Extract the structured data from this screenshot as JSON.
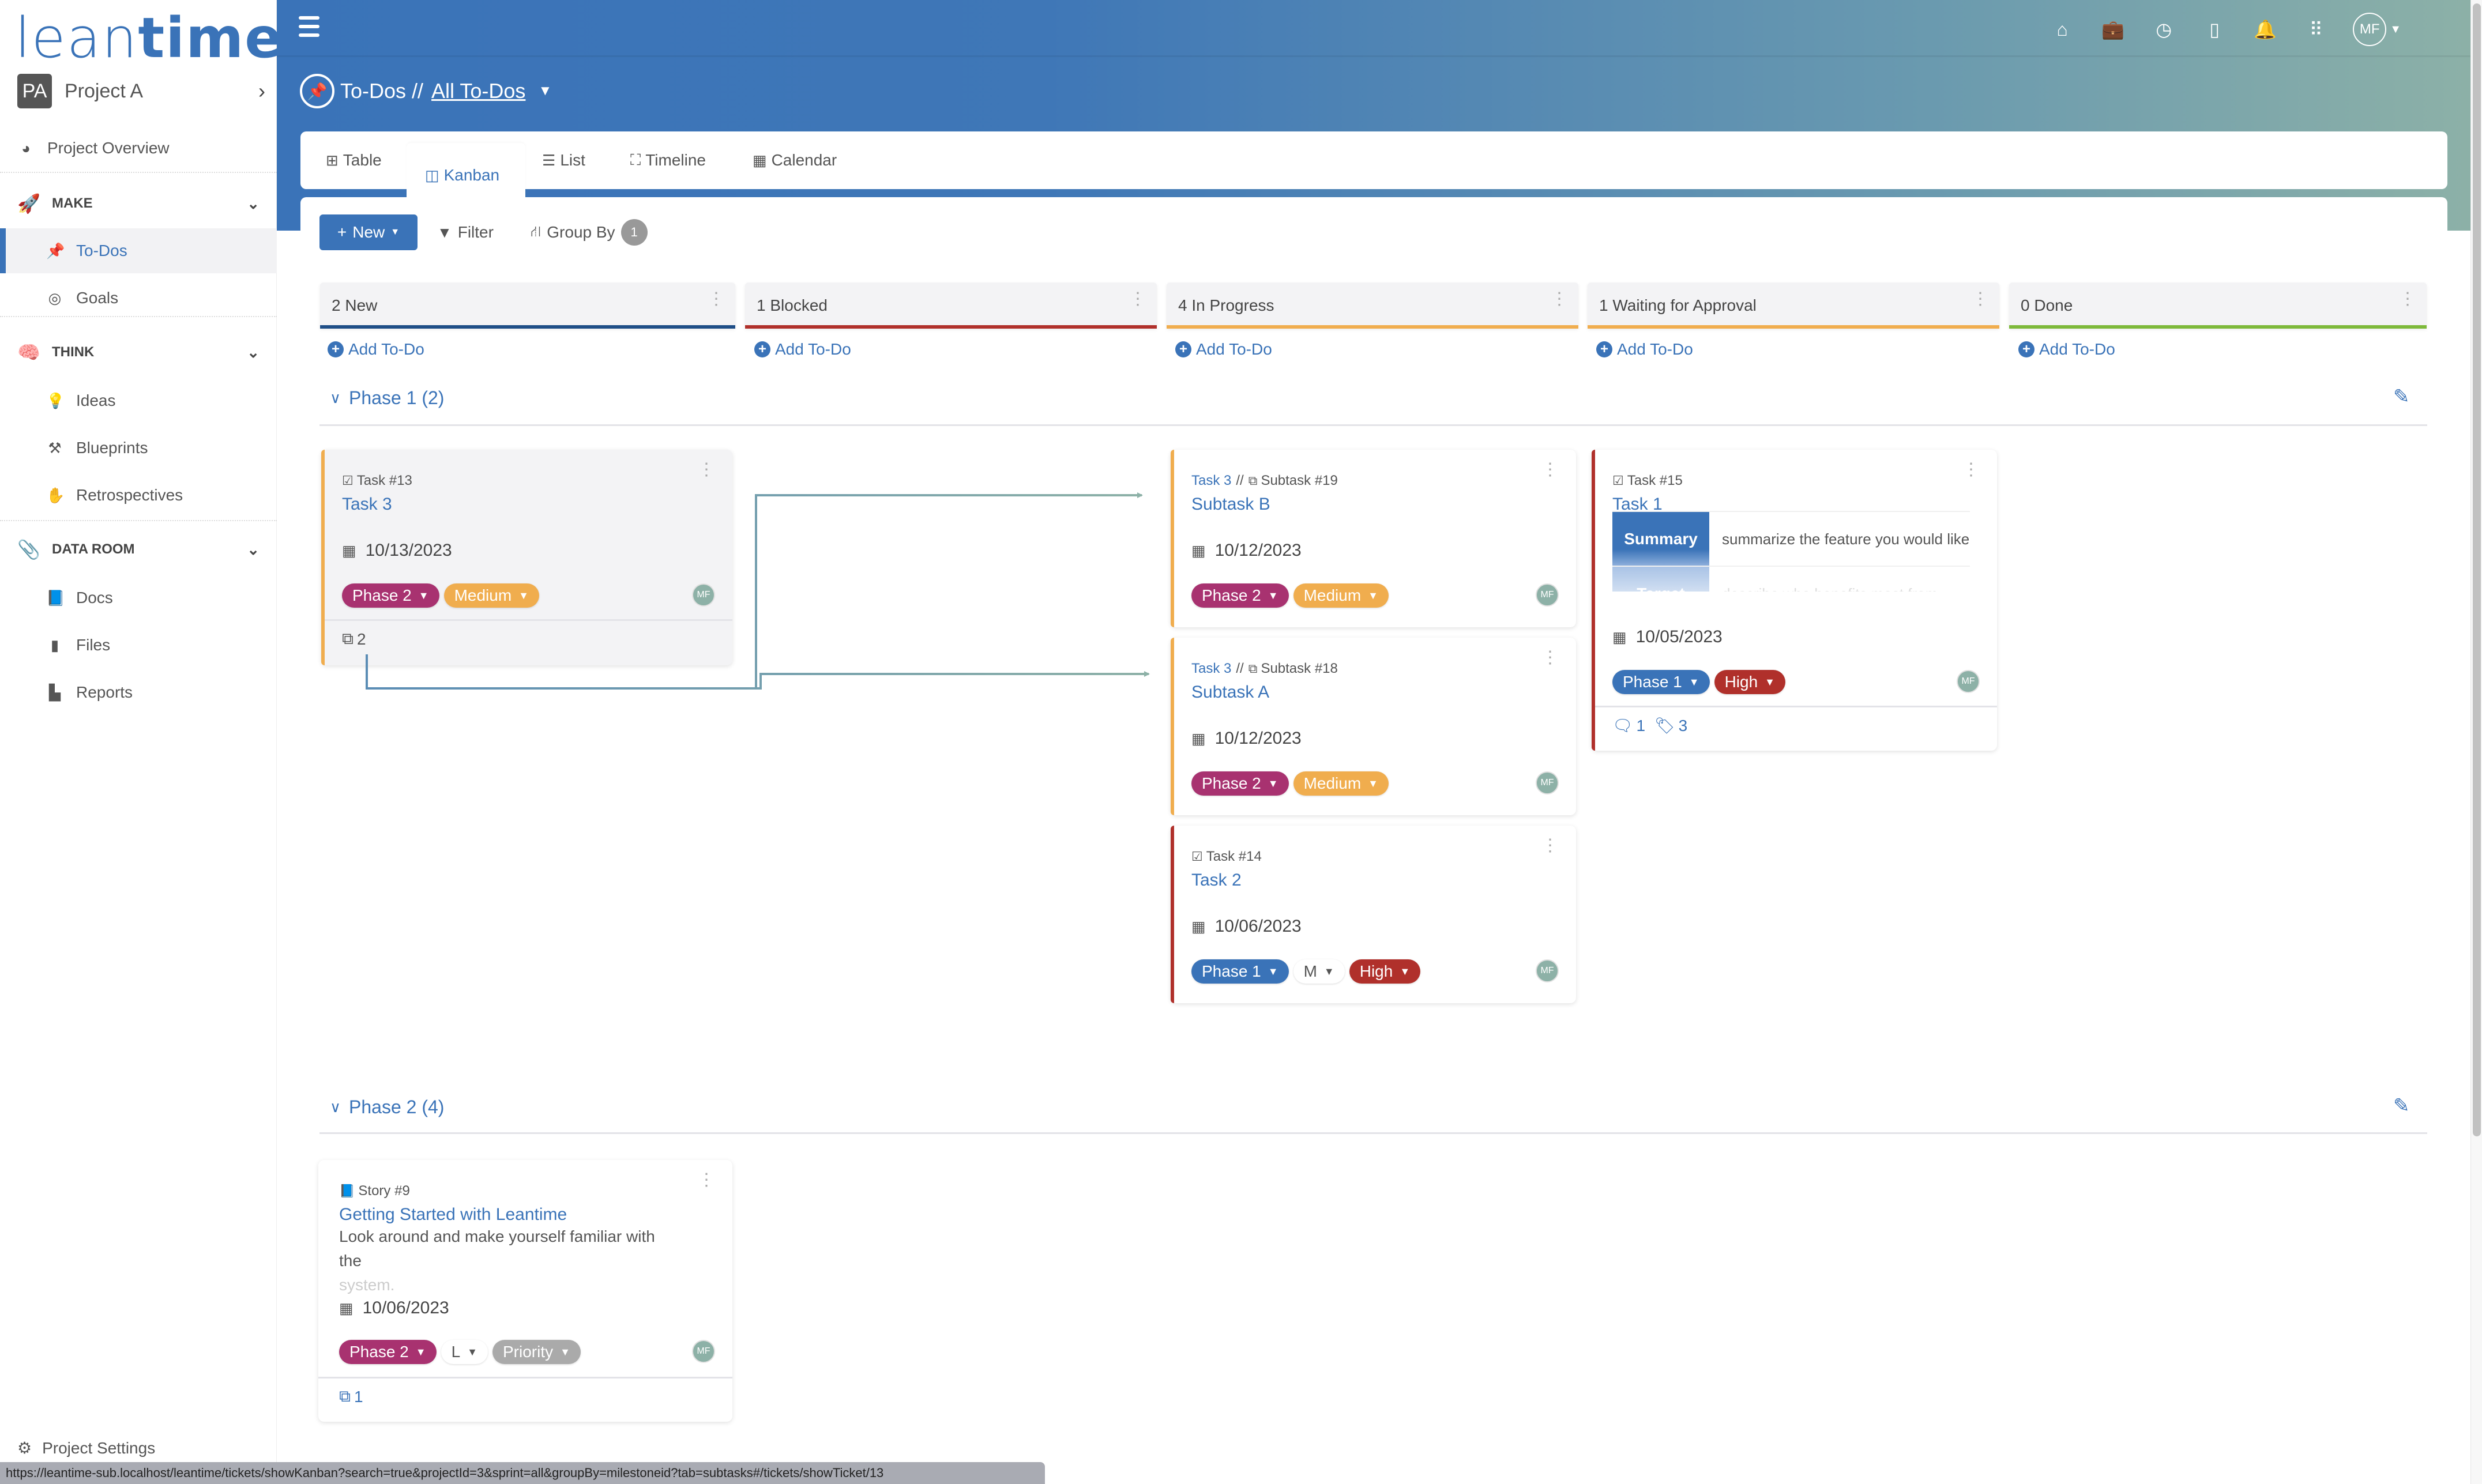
{
  "app": {
    "logo_light": "lean",
    "logo_bold": "time"
  },
  "project": {
    "initials": "PA",
    "name": "Project A"
  },
  "sidebar": {
    "overview": {
      "label": "Project Overview",
      "icon": "gauge-icon"
    },
    "sections": [
      {
        "label": "MAKE",
        "emoji": "🚀",
        "items": [
          {
            "label": "To-Dos",
            "icon": "pin-icon",
            "active": true
          },
          {
            "label": "Goals",
            "icon": "target-icon"
          }
        ]
      },
      {
        "label": "THINK",
        "emoji": "🧠",
        "items": [
          {
            "label": "Ideas",
            "icon": "lightbulb-icon"
          },
          {
            "label": "Blueprints",
            "icon": "compass-icon"
          },
          {
            "label": "Retrospectives",
            "icon": "hand-icon"
          }
        ]
      },
      {
        "label": "DATA ROOM",
        "emoji": "📎",
        "items": [
          {
            "label": "Docs",
            "icon": "book-icon"
          },
          {
            "label": "Files",
            "icon": "file-icon"
          },
          {
            "label": "Reports",
            "icon": "chart-icon"
          }
        ]
      }
    ],
    "settings": {
      "label": "Project Settings",
      "icon": "gear-icon"
    }
  },
  "header": {
    "breadcrumb_root": "To-Dos //",
    "breadcrumb_current": "All To-Dos",
    "user_initials": "MF"
  },
  "tabs": [
    {
      "label": "Table",
      "icon": "⊞"
    },
    {
      "label": "Kanban",
      "icon": "◫",
      "active": true
    },
    {
      "label": "List",
      "icon": "☰"
    },
    {
      "label": "Timeline",
      "icon": "⛶"
    },
    {
      "label": "Calendar",
      "icon": "▦"
    }
  ],
  "toolbar": {
    "new_label": "New",
    "filter_label": "Filter",
    "group_by_label": "Group By",
    "group_by_count": "1"
  },
  "columns": [
    {
      "label": "2 New",
      "color": "#1f4e87"
    },
    {
      "label": "1 Blocked",
      "color": "#b0302b"
    },
    {
      "label": "4 In Progress",
      "color": "#f0ad4e"
    },
    {
      "label": "1 Waiting for Approval",
      "color": "#f0ad4e"
    },
    {
      "label": "0 Done",
      "color": "#7db93a"
    }
  ],
  "add_todo_label": "Add To-Do",
  "swimlanes": [
    {
      "title": "Phase 1 (2)"
    },
    {
      "title": "Phase 2 (4)"
    }
  ],
  "cards": {
    "task13": {
      "type": "Task #13",
      "title": "Task 3",
      "date": "10/13/2023",
      "milestone": "Phase 2",
      "priority": "Medium",
      "assignee": "MF",
      "subtasks": "2"
    },
    "sub19": {
      "parent": "Task 3",
      "sep": "//",
      "type": "Subtask #19",
      "title": "Subtask B",
      "date": "10/12/2023",
      "milestone": "Phase 2",
      "priority": "Medium",
      "assignee": "MF"
    },
    "sub18": {
      "parent": "Task 3",
      "sep": "//",
      "type": "Subtask #18",
      "title": "Subtask A",
      "date": "10/12/2023",
      "milestone": "Phase 2",
      "priority": "Medium",
      "assignee": "MF"
    },
    "task14": {
      "type": "Task #14",
      "title": "Task 2",
      "date": "10/06/2023",
      "milestone": "Phase 1",
      "effort": "M",
      "priority": "High",
      "assignee": "MF"
    },
    "task15": {
      "type": "Task #15",
      "title": "Task 1",
      "summary_label": "Summary",
      "summary_text": "summarize the feature you would like",
      "target_label": "Target",
      "target_text": "describe who benefits most from",
      "date": "10/05/2023",
      "milestone": "Phase 1",
      "priority": "High",
      "assignee": "MF",
      "comments": "1",
      "tags": "3"
    },
    "story9": {
      "type": "Story #9",
      "title": "Getting Started with Leantime",
      "desc": "Look around and make yourself familiar with the",
      "desc_fade": "system.",
      "date": "10/06/2023",
      "milestone": "Phase 2",
      "effort": "L",
      "priority": "Priority",
      "assignee": "MF",
      "subtasks": "1"
    }
  },
  "colors": {
    "primary": "#3a73b8",
    "phase2": "#a83270",
    "medium": "#f0ad4e",
    "high": "#b0302b",
    "phase1": "#3a73b8",
    "priority_none": "#aaaaaa"
  },
  "status_url": "https://leantime-sub.localhost/leantime/tickets/showKanban?search=true&projectId=3&sprint=all&groupBy=milestoneid?tab=subtasks#/tickets/showTicket/13"
}
